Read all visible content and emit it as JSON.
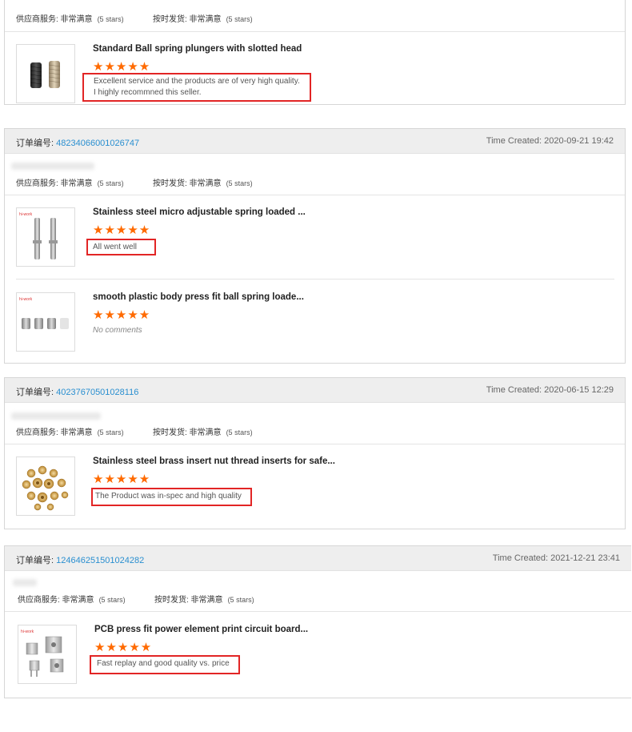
{
  "labels": {
    "supplier_service": "供应商服务: 非常满意",
    "on_time_shipping": "按时发货: 非常满意",
    "stars_text": "(5 stars)",
    "order_no_label": "订单编号: ",
    "time_created_label": "Time Created: "
  },
  "colors": {
    "star": "#ff6a00",
    "order_link": "#2a8fd0",
    "highlight_border": "#e22525",
    "header_bg": "#eeeeee"
  },
  "rating_stars": "★★★★★",
  "orders": [
    {
      "order_no": "",
      "time_created": "",
      "items": [
        {
          "title": "Standard Ball spring plungers with slotted head",
          "review_lines": [
            "Excellent service and the products are of very high quality.",
            "I highly recommned this seller."
          ],
          "thumb_icon": "black-silver-ball-plungers-image"
        }
      ]
    },
    {
      "order_no": "48234066001026747",
      "time_created": "2020-09-21 19:42",
      "items": [
        {
          "title": "Stainless steel micro adjustable spring loaded ...",
          "review_lines": [
            "All went well"
          ],
          "thumb_icon": "steel-pin-plungers-image"
        },
        {
          "title": "smooth plastic body press fit ball spring loade...",
          "review_lines": [
            "No comments"
          ],
          "thumb_icon": "plastic-press-fit-plungers-image"
        }
      ]
    },
    {
      "order_no": "40237670501028116",
      "time_created": "2020-06-15 12:29",
      "items": [
        {
          "title": "Stainless steel brass insert nut thread inserts for safe...",
          "review_lines": [
            "The Product was in-spec and high quality"
          ],
          "thumb_icon": "brass-insert-nuts-image"
        }
      ]
    },
    {
      "order_no": "124646251501024282",
      "time_created": "2021-12-21 23:41",
      "items": [
        {
          "title": "PCB press fit power element print circuit board...",
          "review_lines": [
            "Fast replay and good quality vs. price"
          ],
          "thumb_icon": "pcb-power-elements-image"
        }
      ]
    }
  ]
}
